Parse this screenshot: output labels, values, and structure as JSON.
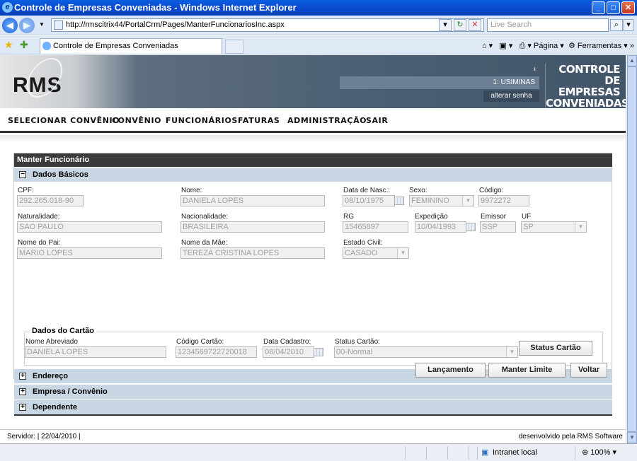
{
  "window": {
    "title": "Controle de Empresas Conveniadas - Windows Internet Explorer"
  },
  "browser": {
    "url": "http://rmscitrix44/PortalCrm/Pages/ManterFuncionariosInc.aspx",
    "search_placeholder": "Live Search",
    "tab_title": "Controle de Empresas Conveniadas",
    "tools": {
      "page": "Página",
      "tools": "Ferramentas"
    },
    "status_zone": "Intranet local",
    "zoom": "100%"
  },
  "header": {
    "logo": "RMS",
    "user": "1: USIMINAS",
    "change_password": "alterar senha",
    "brand_lines": [
      "CONTROLE",
      "DE EMPRESAS",
      "CONVENIADAS"
    ]
  },
  "menu": [
    "SELECIONAR CONVÊNIO",
    "CONVÊNIO",
    "FUNCIONÁRIOS",
    "FATURAS",
    "ADMINISTRAÇÃO",
    "SAIR"
  ],
  "form": {
    "title": "Manter Funcionário",
    "sections": {
      "basic": "Dados Básicos",
      "address": "Endereço",
      "company": "Empresa / Convênio",
      "dependent": "Dependente"
    },
    "fields": {
      "cpf": {
        "label": "CPF:",
        "value": "292.265.018-90"
      },
      "nome": {
        "label": "Nome:",
        "value": "DANIELA LOPES"
      },
      "data_nasc": {
        "label": "Data de Nasc.:",
        "value": "08/10/1975"
      },
      "sexo": {
        "label": "Sexo:",
        "value": "FEMININO"
      },
      "codigo": {
        "label": "Código:",
        "value": "9972272"
      },
      "naturalidade": {
        "label": "Naturalidade:",
        "value": "SAO PAULO"
      },
      "nacionalidade": {
        "label": "Nacionalidade:",
        "value": "BRASILEIRA"
      },
      "rg": {
        "label": "RG",
        "value": "15465897"
      },
      "expedicao": {
        "label": "Expedição",
        "value": "10/04/1993"
      },
      "emissor": {
        "label": "Emissor",
        "value": "SSP"
      },
      "uf": {
        "label": "UF",
        "value": "SP"
      },
      "pai": {
        "label": "Nome do Pai:",
        "value": "MARIO LOPES"
      },
      "mae": {
        "label": "Nome da Mãe:",
        "value": "TEREZA CRISTINA LOPES"
      },
      "estado_civil": {
        "label": "Estado Civil:",
        "value": "CASADO"
      }
    },
    "card": {
      "legend": "Dados do Cartão",
      "nome_abreviado": {
        "label": "Nome Abreviado",
        "value": "DANIELA LOPES"
      },
      "codigo_cartao": {
        "label": "Código Cartão:",
        "value": "1234569722720018"
      },
      "data_cadastro": {
        "label": "Data Cadastro:",
        "value": "08/04/2010"
      },
      "status_cartao": {
        "label": "Status Cartão:",
        "value": "00-Normal"
      },
      "status_button": "Status Cartão"
    },
    "buttons": {
      "lancamento": "Lançamento",
      "manter_limite": "Manter Limite",
      "voltar": "Voltar"
    }
  },
  "footer": {
    "server": "Servidor:  |  22/04/2010  |",
    "developed_by": "desenvolvido pela RMS Software"
  }
}
